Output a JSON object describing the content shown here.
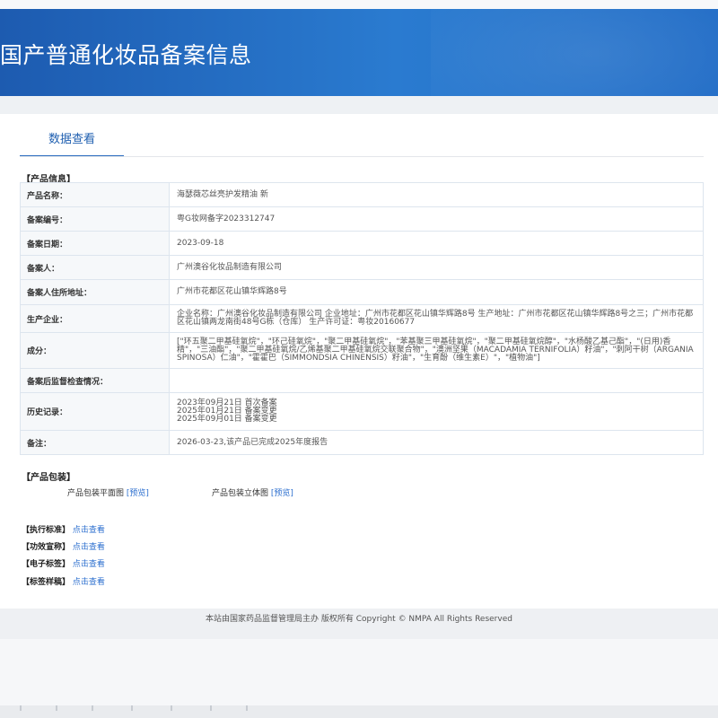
{
  "header": {
    "title": "国产普通化妆品备案信息"
  },
  "tab": {
    "label": "数据查看"
  },
  "product_info": {
    "section_title": "【产品信息】",
    "rows": [
      {
        "label": "产品名称：",
        "value": "海瑟薇芯丝亮护发精油 新"
      },
      {
        "label": "备案编号：",
        "value": "粤G妆网备字2023312747"
      },
      {
        "label": "备案日期：",
        "value": "2023-09-18"
      },
      {
        "label": "备案人：",
        "value": "广州澳谷化妆品制造有限公司"
      },
      {
        "label": "备案人住所地址：",
        "value": "广州市花都区花山镇华辉路8号"
      },
      {
        "label": "生产企业：",
        "value": "企业名称：广州澳谷化妆品制造有限公司 企业地址：广州市花都区花山镇华辉路8号 生产地址：广州市花都区花山镇华辉路8号之三；广州市花都区花山镇两龙南街48号G栋（仓库） 生产许可证：粤妆20160677"
      },
      {
        "label": "成分：",
        "value": "[\"环五聚二甲基硅氧烷\"，\"环己硅氧烷\"，\"聚二甲基硅氧烷\"，\"苯基聚三甲基硅氧烷\"，\"聚二甲基硅氧烷醇\"，\"水杨酸乙基己酯\"，\"(日用)香精\"，\"三油酯\"，\"聚二甲基硅氧烷/乙烯基聚二甲基硅氧烷交联聚合物\"，\"澳洲坚果（MACADAMIA TERNIFOLIA）籽油\"，\"刺阿干树（ARGANIA SPINOSA）仁油\"，\"霍霍巴（SIMMONDSIA CHINENSIS）籽油\"，\"生育酚（维生素E）\"，\"植物油\"]"
      },
      {
        "label": "备案后监督检查情况：",
        "value": ""
      },
      {
        "label": "历史记录：",
        "value": "2023年09月21日 首次备案\n2025年01月21日 备案变更\n2025年09月01日 备案变更"
      },
      {
        "label": "备注：",
        "value": "2026-03-23,该产品已完成2025年度报告"
      }
    ]
  },
  "packaging": {
    "section_title": "【产品包装】",
    "flat_label": "产品包装平面图",
    "stereo_label": "产品包装立体图",
    "preview_label": "[预览]"
  },
  "links": [
    {
      "label": "【执行标准】",
      "action": "点击查看"
    },
    {
      "label": "【功效宣称】",
      "action": "点击查看"
    },
    {
      "label": "【电子标签】",
      "action": "点击查看"
    },
    {
      "label": "【标签样稿】",
      "action": "点击查看"
    }
  ],
  "footer": {
    "text": "本站由国家药品监督管理局主办 版权所有 Copyright © NMPA All Rights Reserved"
  }
}
